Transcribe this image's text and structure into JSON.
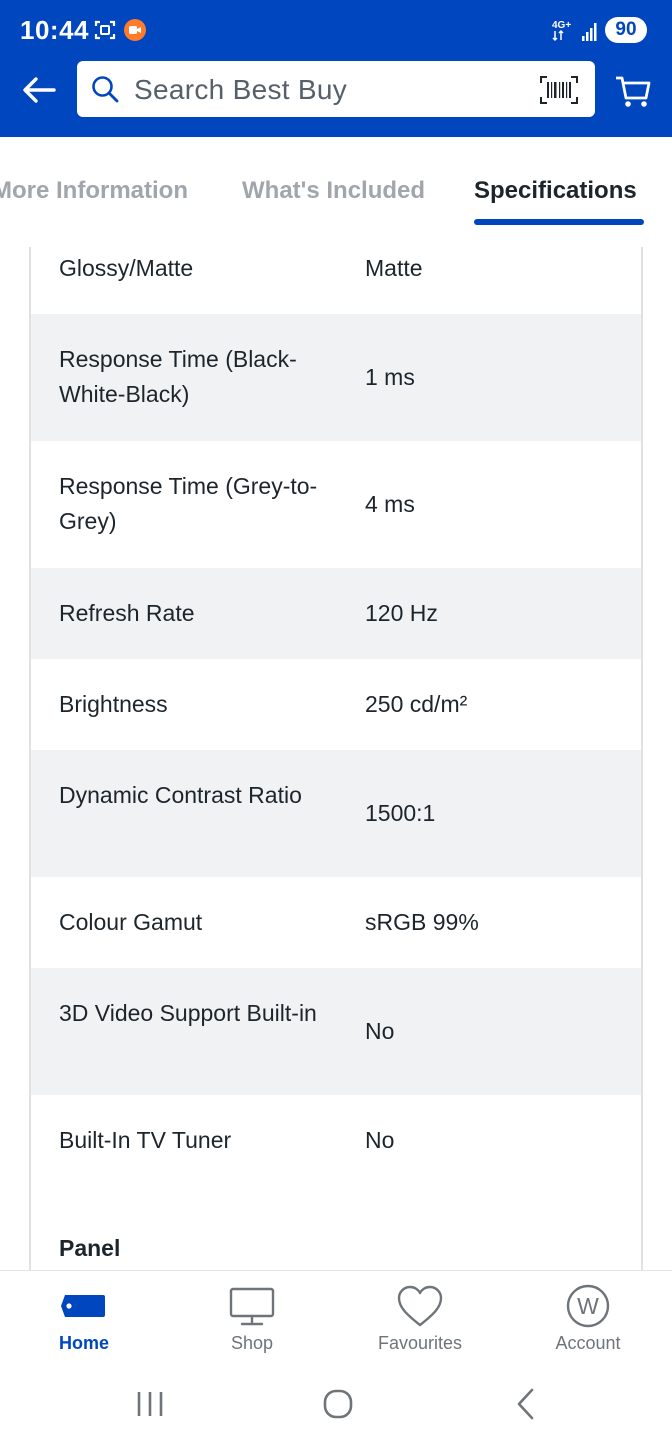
{
  "status_bar": {
    "time": "10:44",
    "network_label": "4G+",
    "battery": "90"
  },
  "header": {
    "search_placeholder": "Search Best Buy",
    "icons": [
      "back-arrow-icon",
      "search-icon",
      "barcode-scan-icon",
      "cart-icon"
    ]
  },
  "tabs": [
    {
      "label": "More Information",
      "active": false
    },
    {
      "label": "What's Included",
      "active": false
    },
    {
      "label": "Specifications",
      "active": true
    }
  ],
  "specs": [
    {
      "label": "Glossy/Matte",
      "value": "Matte"
    },
    {
      "label": "Response Time (Black-White-Black)",
      "value": "1 ms"
    },
    {
      "label": "Response Time (Grey-to-Grey)",
      "value": "4 ms"
    },
    {
      "label": "Refresh Rate",
      "value": "120 Hz"
    },
    {
      "label": "Brightness",
      "value": "250 cd/m²"
    },
    {
      "label": "Dynamic Contrast Ratio",
      "value": "1500:1"
    },
    {
      "label": "Colour Gamut",
      "value": "sRGB 99%"
    },
    {
      "label": "3D Video Support Built-in",
      "value": "No"
    },
    {
      "label": "Built-In TV Tuner",
      "value": "No"
    }
  ],
  "next_section": "Panel",
  "bottom_nav": [
    {
      "label": "Home",
      "icon": "tag-icon",
      "active": true
    },
    {
      "label": "Shop",
      "icon": "monitor-icon",
      "active": false
    },
    {
      "label": "Favourites",
      "icon": "heart-icon",
      "active": false
    },
    {
      "label": "Account",
      "icon": "account-w-icon",
      "active": false
    }
  ],
  "account_letter": "W",
  "colors": {
    "brand_blue": "#0046be",
    "row_shade": "#f0f2f4",
    "text": "#1d252c",
    "muted": "#a0a6ab"
  }
}
